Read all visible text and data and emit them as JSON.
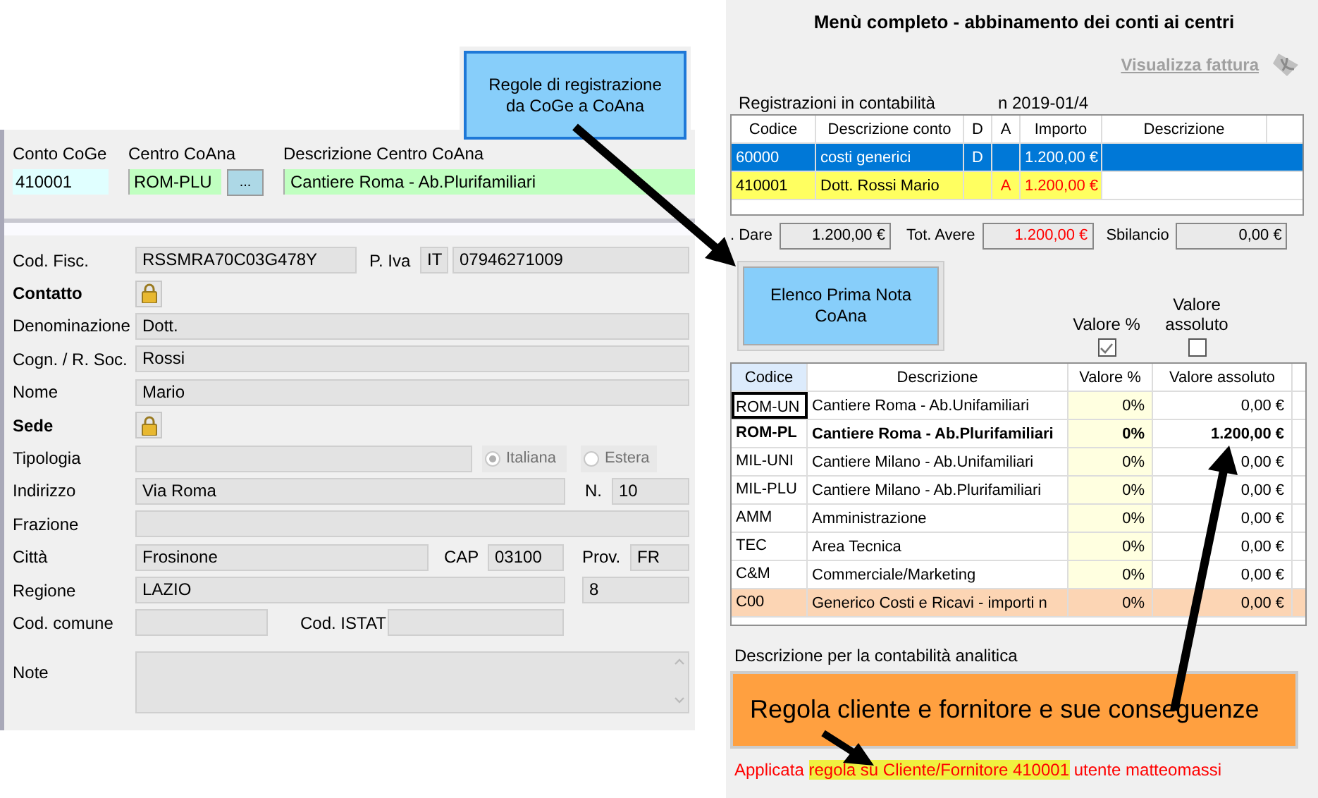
{
  "rule_button": {
    "label": "Regole di registrazione da CoGe a CoAna"
  },
  "account_panel": {
    "conto_coge": {
      "label": "Conto CoGe",
      "value": "410001"
    },
    "centro_coana": {
      "label": "Centro CoAna",
      "value": "ROM-PLU",
      "button": "..."
    },
    "descrizione_centro": {
      "label": "Descrizione Centro CoAna",
      "value": "Cantiere Roma - Ab.Plurifamiliari"
    }
  },
  "anagrafica": {
    "cod_fisc": {
      "label": "Cod. Fisc.",
      "value": "RSSMRA70C03G478Y"
    },
    "p_iva": {
      "label": "P. Iva",
      "country": "IT",
      "value": "07946271009"
    },
    "contatto": {
      "label": "Contatto"
    },
    "denominazione": {
      "label": "Denominazione",
      "value": "Dott."
    },
    "cognome": {
      "label": "Cogn. / R. Soc.",
      "value": "Rossi"
    },
    "nome": {
      "label": "Nome",
      "value": "Mario"
    },
    "sede": {
      "label": "Sede"
    },
    "tipologia": {
      "label": "Tipologia",
      "options": [
        {
          "label": "Italiana",
          "selected": true
        },
        {
          "label": "Estera",
          "selected": false
        }
      ]
    },
    "indirizzo": {
      "label": "Indirizzo",
      "value": "Via Roma"
    },
    "numero": {
      "label": "N.",
      "value": "10"
    },
    "frazione": {
      "label": "Frazione"
    },
    "citta": {
      "label": "Città",
      "value": "Frosinone"
    },
    "cap": {
      "label": "CAP",
      "value": "03100"
    },
    "prov": {
      "label": "Prov.",
      "value": "FR"
    },
    "regione": {
      "label": "Regione",
      "value": "LAZIO"
    },
    "regione_codice": {
      "value": "8"
    },
    "cod_comune": {
      "label": "Cod. comune"
    },
    "cod_istat": {
      "label": "Cod. ISTAT"
    },
    "note": {
      "label": "Note"
    }
  },
  "menu": {
    "title": "Menù completo - abbinamento dei conti ai centri",
    "invoice_link": "Visualizza fattura",
    "registrations_label": "Registrazioni in contabilità",
    "registration_number": "n 2019-01/4",
    "registrations": {
      "columns": [
        "Codice",
        "Descrizione conto",
        "D",
        "A",
        "Importo",
        "Descrizione"
      ],
      "rows": [
        {
          "codice": "60000",
          "descrizione": "costi generici",
          "d": "D",
          "a": "",
          "importo": "1.200,00 €",
          "selected": true,
          "highlighted": false
        },
        {
          "codice": "410001",
          "descrizione": "Dott. Rossi Mario",
          "d": "",
          "a": "A",
          "importo": "1.200,00 €",
          "selected": false,
          "highlighted": true
        }
      ]
    },
    "totals": [
      {
        "label": ". Dare",
        "value": "1.200,00 €",
        "negative": false
      },
      {
        "label": "Tot. Avere",
        "value": "1.200,00 €",
        "negative": true
      },
      {
        "label": "Sbilancio",
        "value": "0,00 €",
        "negative": false
      }
    ],
    "prima_nota_button": "Elenco Prima Nota CoAna",
    "options": [
      {
        "label": "Valore %",
        "checked": true
      },
      {
        "label": "Valore assoluto",
        "checked": false
      }
    ],
    "centers": {
      "columns": [
        "Codice",
        "Descrizione",
        "Valore %",
        "Valore assoluto"
      ],
      "rows": [
        {
          "codice": "ROM-UN",
          "descrizione": "Cantiere Roma - Ab.Unifamiliari",
          "percent": "0%",
          "amount": "0,00 €",
          "focused": true,
          "selected": false,
          "highlighted": false
        },
        {
          "codice": "ROM-PL",
          "descrizione": "Cantiere Roma - Ab.Plurifamiliari",
          "percent": "0%",
          "amount": "1.200,00 €",
          "focused": false,
          "selected": true,
          "highlighted": false
        },
        {
          "codice": "MIL-UNI",
          "descrizione": "Cantiere Milano - Ab.Unifamiliari",
          "percent": "0%",
          "amount": "0,00 €",
          "focused": false,
          "selected": false,
          "highlighted": false
        },
        {
          "codice": "MIL-PLU",
          "descrizione": "Cantiere Milano - Ab.Plurifamiliari",
          "percent": "0%",
          "amount": "0,00 €",
          "focused": false,
          "selected": false,
          "highlighted": false
        },
        {
          "codice": "AMM",
          "descrizione": "Amministrazione",
          "percent": "0%",
          "amount": "0,00 €",
          "focused": false,
          "selected": false,
          "highlighted": false
        },
        {
          "codice": "TEC",
          "descrizione": "Area Tecnica",
          "percent": "0%",
          "amount": "0,00 €",
          "focused": false,
          "selected": false,
          "highlighted": false
        },
        {
          "codice": "C&M",
          "descrizione": "Commerciale/Marketing",
          "percent": "0%",
          "amount": "0,00 €",
          "focused": false,
          "selected": false,
          "highlighted": false
        },
        {
          "codice": "C00",
          "descrizione": "Generico Costi e Ricavi - importi n",
          "percent": "0%",
          "amount": "0,00 €",
          "focused": false,
          "selected": false,
          "highlighted": true
        }
      ]
    },
    "description_label": "Descrizione per la contabilità analitica",
    "description_value": "Regola cliente e fornitore e sue conseguenze",
    "applied_note": [
      {
        "text": "Applicata",
        "highlighted": false
      },
      {
        "text": "regola su Cliente/Fornitore 410001",
        "highlighted": true
      },
      {
        "text": "utente matteomassi",
        "highlighted": false
      }
    ]
  }
}
